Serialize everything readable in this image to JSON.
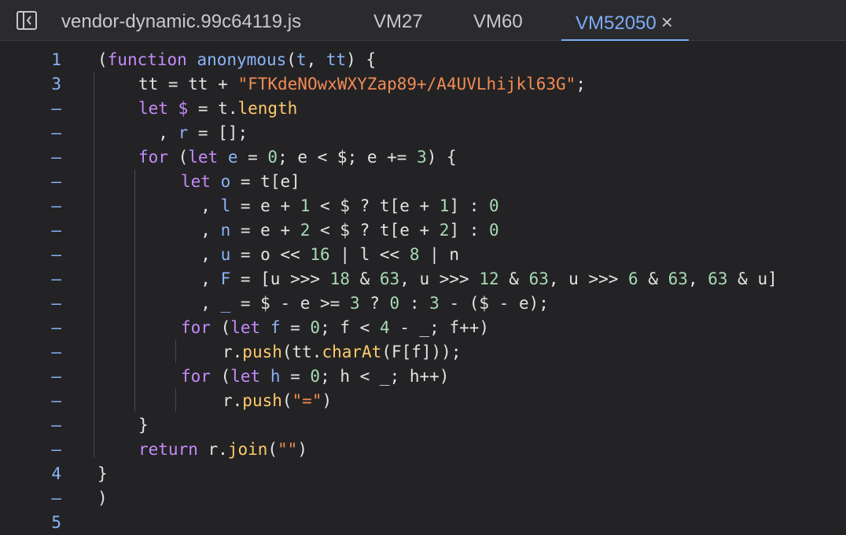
{
  "tabs": {
    "t0": "vendor-dynamic.99c64119.js",
    "t1": "VM27",
    "t2": "VM60",
    "t3": "VM52050",
    "close": "×"
  },
  "gutter": [
    "1",
    "3",
    "–",
    "–",
    "–",
    "–",
    "–",
    "–",
    "–",
    "–",
    "–",
    "–",
    "–",
    "–",
    "–",
    "–",
    "–",
    "4",
    "–",
    "5"
  ],
  "code": {
    "l1": {
      "a": "(",
      "b": "function",
      "c": " ",
      "d": "anonymous",
      "e": "(",
      "f": "t",
      ",": ", ",
      "g": "tt",
      "h": ") {"
    },
    "l2": {
      "a": "tt = tt + ",
      "b": "\"FTKdeNOwxWXYZap89+/A4UVLhijkl63G\"",
      "c": ";"
    },
    "l3": {
      "a": "let",
      "b": " ",
      "c": "$",
      "d": " = t.",
      "e": "length"
    },
    "l4": {
      "a": "  , ",
      "b": "r",
      "c": " = [];"
    },
    "l5": {
      "a": "for",
      "b": " (",
      "c": "let",
      "d": " ",
      "e": "e",
      "f": " = ",
      "g": "0",
      "h": "; e < $; e += ",
      "i": "3",
      "j": ") {"
    },
    "l6": {
      "a": "let",
      "b": " ",
      "c": "o",
      "d": " = t[e]"
    },
    "l7": {
      "a": "  , ",
      "b": "l",
      "c": " = e + ",
      "d": "1",
      "e": " < $ ? t[e + ",
      "f": "1",
      "g": "] : ",
      "h": "0"
    },
    "l8": {
      "a": "  , ",
      "b": "n",
      "c": " = e + ",
      "d": "2",
      "e": " < $ ? t[e + ",
      "f": "2",
      "g": "] : ",
      "h": "0"
    },
    "l9": {
      "a": "  , ",
      "b": "u",
      "c": " = o << ",
      "d": "16",
      "e": " | l << ",
      "f": "8",
      "g": " | n"
    },
    "l10": {
      "a": "  , ",
      "b": "F",
      "c": " = [u >>> ",
      "d": "18",
      "e": " & ",
      "f": "63",
      "g": ", u >>> ",
      "h": "12",
      "i": " & ",
      "j": "63",
      "k": ", u >>> ",
      "l": "6",
      "m": " & ",
      "n": "63",
      "o": ", ",
      "p": "63",
      "q": " & u]"
    },
    "l11": {
      "a": "  , ",
      "b": "_",
      "c": " = $ - e >= ",
      "d": "3",
      "e": " ? ",
      "f": "0",
      "g": " : ",
      "h": "3",
      "i": " - ($ - e);"
    },
    "l12": {
      "a": "for",
      "b": " (",
      "c": "let",
      "d": " ",
      "e": "f",
      "f": " = ",
      "g": "0",
      "h": "; f < ",
      "i": "4",
      "j": " - _; f++)"
    },
    "l13": {
      "a": "r.",
      "b": "push",
      "c": "(tt.",
      "d": "charAt",
      "e": "(F[f]));"
    },
    "l14": {
      "a": "for",
      "b": " (",
      "c": "let",
      "d": " ",
      "e": "h",
      "f": " = ",
      "g": "0",
      "h": "; h < _; h++)"
    },
    "l15": {
      "a": "r.",
      "b": "push",
      "c": "(",
      "d": "\"=\"",
      "e": ")"
    },
    "l16": {
      "a": "}"
    },
    "l17": {
      "a": "return",
      "b": " r.",
      "c": "join",
      "d": "(",
      "e": "\"\"",
      "f": ")"
    },
    "l18": {
      "a": "}"
    },
    "l19": {
      "a": ")"
    },
    "l20": {
      "a": ""
    }
  },
  "colors": {
    "accent": "#7cacf8",
    "keyword": "#c58af9",
    "string": "#f28b54",
    "number": "#a8dab5",
    "function": "#ffcb6b"
  }
}
